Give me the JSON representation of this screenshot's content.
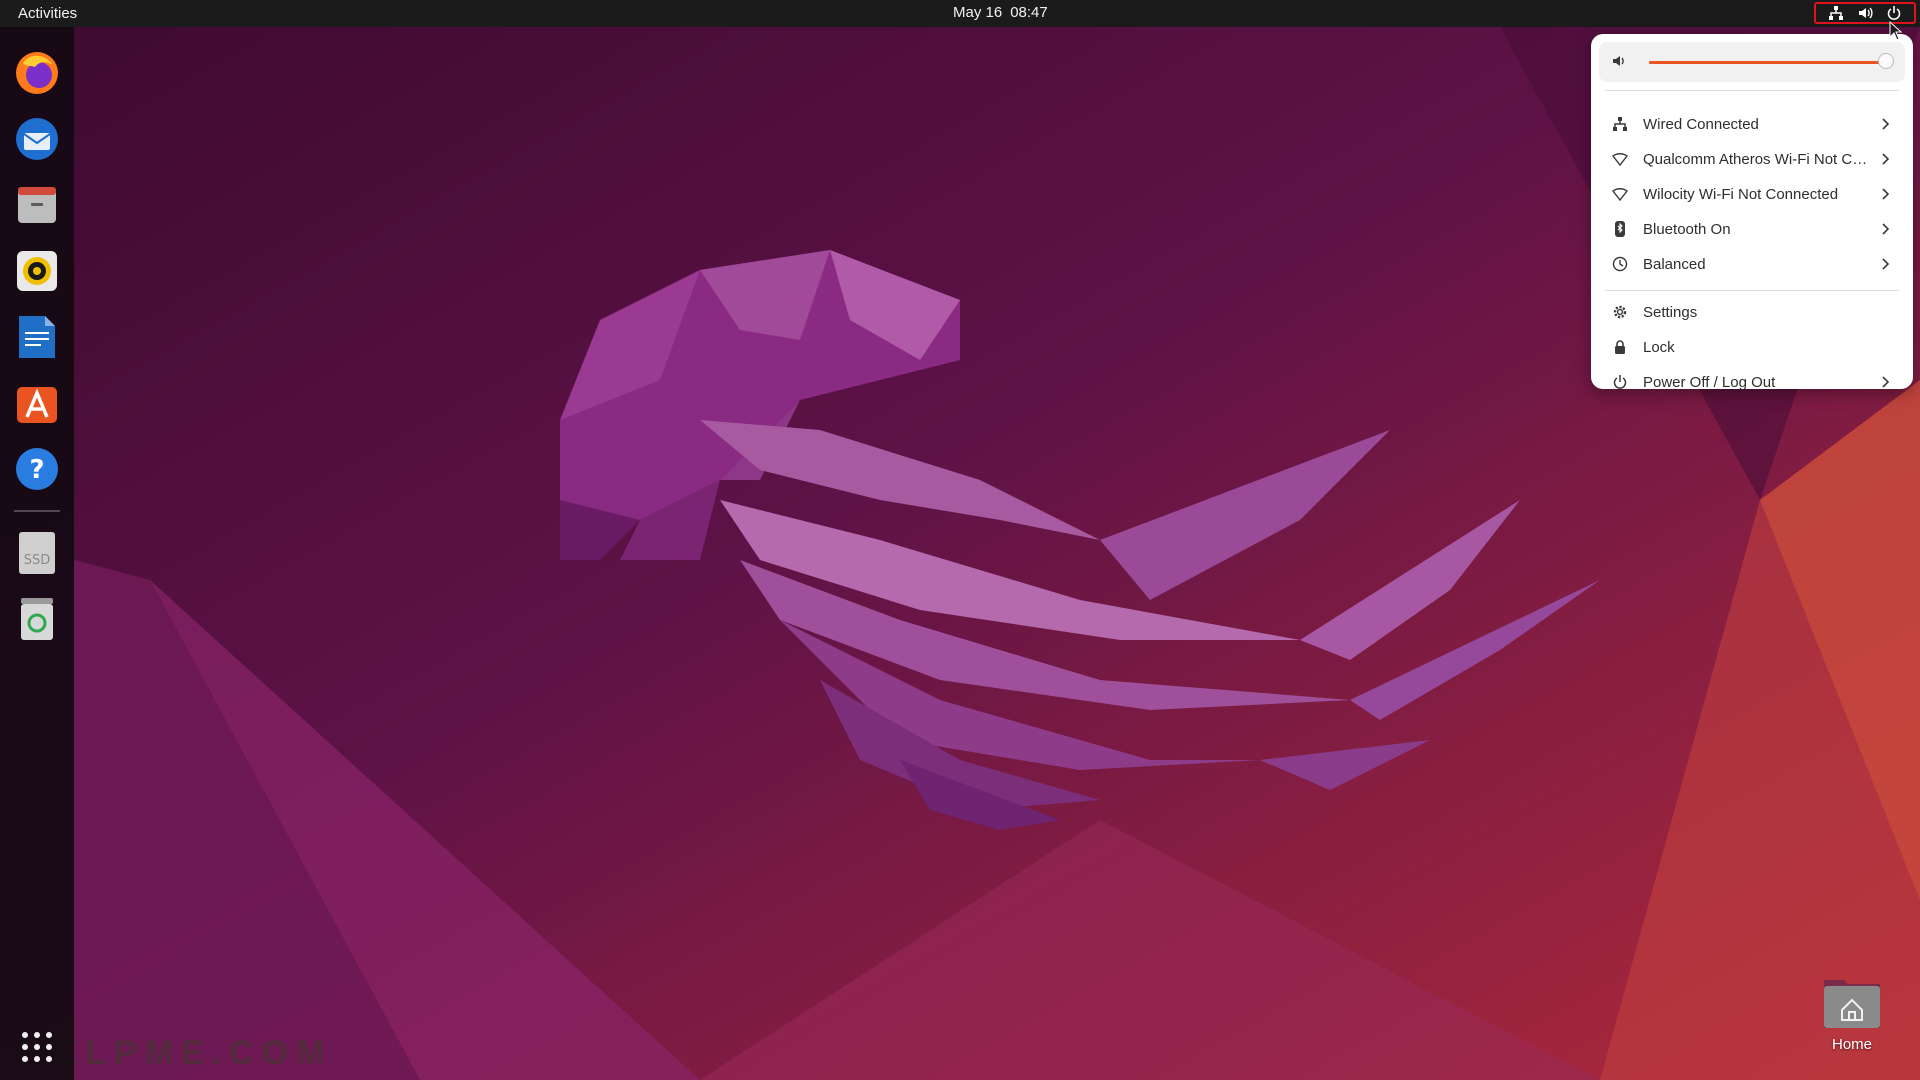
{
  "topbar": {
    "activities": "Activities",
    "date": "May 16",
    "time": "08:47",
    "tray_icons": [
      "network-wired-icon",
      "volume-icon",
      "power-icon"
    ]
  },
  "dock": {
    "apps": [
      {
        "name": "firefox-icon"
      },
      {
        "name": "thunderbird-icon"
      },
      {
        "name": "files-icon"
      },
      {
        "name": "rhythmbox-icon"
      },
      {
        "name": "libreoffice-writer-icon"
      },
      {
        "name": "app-center-icon"
      },
      {
        "name": "help-icon"
      }
    ],
    "drives": [
      {
        "name": "ssd-drive-icon",
        "label": "SSD"
      },
      {
        "name": "trash-icon"
      }
    ],
    "show_apps": "show-apps-grid-icon"
  },
  "watermark": "HELPME.COM",
  "desktop": {
    "home_label": "Home"
  },
  "menu": {
    "volume_level": 0.97,
    "items": [
      {
        "label": "Wired Connected",
        "icon": "network-wired-icon",
        "submenu": true
      },
      {
        "label": "Qualcomm Atheros Wi-Fi Not Connected",
        "icon": "wifi-icon",
        "submenu": true
      },
      {
        "label": "Wilocity Wi-Fi Not Connected",
        "icon": "wifi-icon",
        "submenu": true
      },
      {
        "label": "Bluetooth On",
        "icon": "bluetooth-icon",
        "submenu": true
      },
      {
        "label": "Balanced",
        "icon": "power-profile-icon",
        "submenu": true
      }
    ],
    "actions": [
      {
        "label": "Settings",
        "icon": "gear-icon",
        "submenu": false
      },
      {
        "label": "Lock",
        "icon": "lock-icon",
        "submenu": false
      },
      {
        "label": "Power Off / Log Out",
        "icon": "power-icon",
        "submenu": true
      }
    ]
  },
  "colors": {
    "accent": "#e95420",
    "topbar": "#1b1b1b",
    "highlight": "#e0141f"
  }
}
